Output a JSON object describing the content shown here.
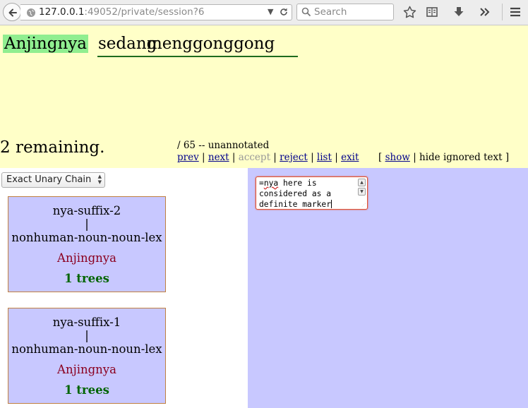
{
  "browser": {
    "url_host": "127.0.0.1",
    "url_rest": ":49052/private/session?6",
    "search_placeholder": "Search",
    "icons": [
      "back-arrow-icon",
      "globe-icon",
      "dropdown-arrow-icon",
      "reload-icon",
      "search-icon",
      "star-icon",
      "reading-list-icon",
      "download-icon",
      "overflow-icon",
      "menu-icon"
    ]
  },
  "sentence": {
    "words": [
      "Anjingnya",
      "sedang",
      "menggonggong"
    ],
    "highlight_color": "#90ee90",
    "background_color": "#ffffc8"
  },
  "progress": {
    "remaining_text": "2 remaining.",
    "status_text": "/ 65 -- unannotated"
  },
  "nav": {
    "prev": "prev",
    "next": "next",
    "accept": "accept",
    "reject": "reject",
    "list": "list",
    "exit": "exit",
    "sep": "|"
  },
  "ignored_text": {
    "open_bracket": "[",
    "show": "show",
    "hide_label": "| hide ignored text ]"
  },
  "filter": {
    "selected": "Exact Unary Chain"
  },
  "candidates": [
    {
      "rule": "nya-suffix-2",
      "bar": "|",
      "lex": "nonhuman-noun-noun-lex",
      "surface": "Anjingnya",
      "trees": "1 trees"
    },
    {
      "rule": "nya-suffix-1",
      "bar": "|",
      "lex": "nonhuman-noun-noun-lex",
      "surface": "Anjingnya",
      "trees": "1 trees"
    }
  ],
  "comment": {
    "prefix": "=",
    "misspelled": "nya",
    "rest": " here is considered as a definite marker"
  },
  "colors": {
    "panel": "#c8c8ff",
    "link": "#00008b",
    "surface": "#8b0020",
    "trees": "#006400",
    "card_border": "#c08040"
  }
}
